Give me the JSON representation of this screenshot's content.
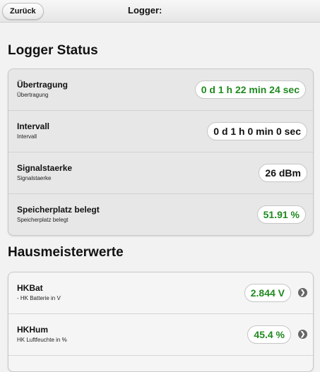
{
  "topbar": {
    "back_label": "Zurück",
    "title": "Logger:"
  },
  "status_section": {
    "title": "Logger Status",
    "rows": [
      {
        "title": "Übertragung",
        "subtitle": "Übertragung",
        "value": "0 d 1 h 22 min 24 sec",
        "color": "#1f8a1f"
      },
      {
        "title": "Intervall",
        "subtitle": "Intervall",
        "value": "0 d 1 h 0 min 0 sec",
        "color": "#111111"
      },
      {
        "title": "Signalstaerke",
        "subtitle": "Signalstaerke",
        "value": "26 dBm",
        "color": "#111111"
      },
      {
        "title": "Speicherplatz belegt",
        "subtitle": "Speicherplatz belegt",
        "value": "51.91 %",
        "color": "#1f8a1f"
      }
    ]
  },
  "hausmeister_section": {
    "title": "Hausmeisterwerte",
    "rows": [
      {
        "title": "HKBat",
        "subtitle": "- HK Batterie in V",
        "value": "2.844 V",
        "color": "#1f8a1f",
        "icon": "chevron-right-icon"
      },
      {
        "title": "HKHum",
        "subtitle": "HK Luftfeuchte in %",
        "value": "45.4 %",
        "color": "#1f8a1f",
        "icon": "chevron-right-icon"
      }
    ]
  }
}
